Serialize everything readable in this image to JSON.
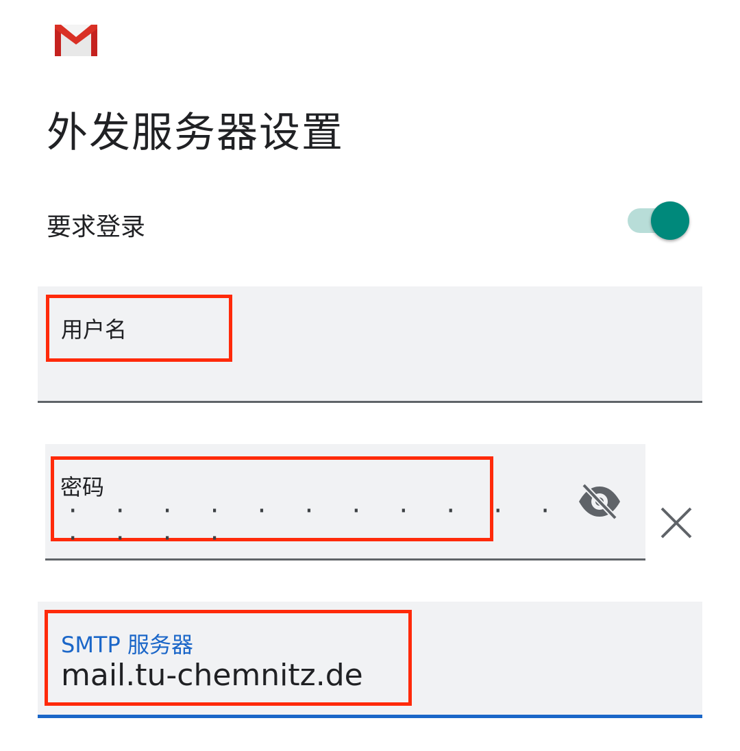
{
  "app": {
    "logo_icon": "gmail-logo-icon",
    "brand_colors": {
      "red": "#d93025",
      "teal": "#00897b",
      "blue": "#1a66c8"
    }
  },
  "page": {
    "title": "外发服务器设置"
  },
  "login": {
    "label": "要求登录",
    "enabled": true
  },
  "username": {
    "label": "用户名",
    "value": ""
  },
  "password": {
    "label": "密码",
    "masked_value": "· · · · · · · · · · · · · · · ·",
    "toggle_icon": "eye-off-icon",
    "clear_icon": "close-icon"
  },
  "smtp": {
    "label": "SMTP 服务器",
    "value": "mail.tu-chemnitz.de"
  }
}
